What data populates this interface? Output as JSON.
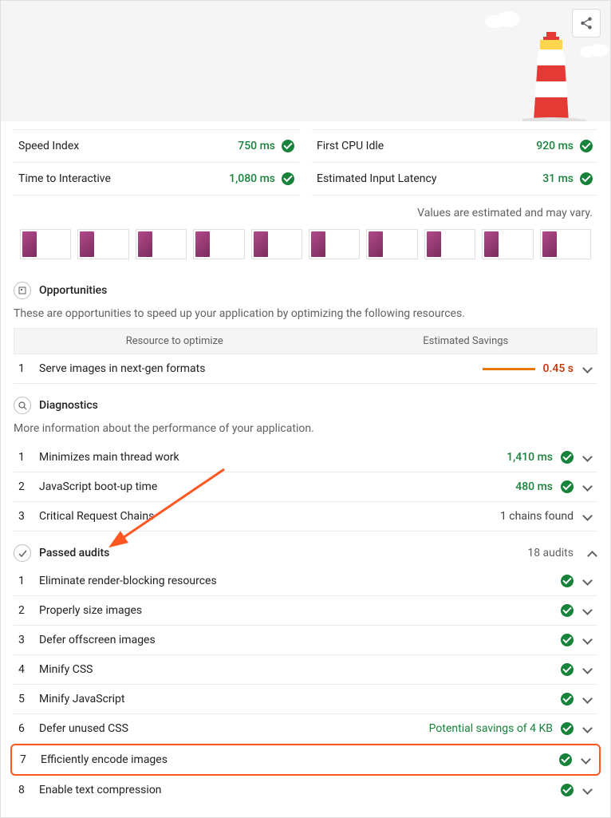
{
  "header": {
    "share_label": "Share"
  },
  "metrics": {
    "left": [
      {
        "label": "Speed Index",
        "value": "750 ms"
      },
      {
        "label": "Time to Interactive",
        "value": "1,080 ms"
      }
    ],
    "right": [
      {
        "label": "First CPU Idle",
        "value": "920 ms"
      },
      {
        "label": "Estimated Input Latency",
        "value": "31 ms"
      }
    ],
    "estimate_note": "Values are estimated and may vary."
  },
  "opportunities": {
    "title": "Opportunities",
    "desc": "These are opportunities to speed up your application by optimizing the following resources.",
    "col_left": "Resource to optimize",
    "col_right": "Estimated Savings",
    "rows": [
      {
        "num": "1",
        "text": "Serve images in next-gen formats",
        "savings": "0.45 s"
      }
    ]
  },
  "diagnostics": {
    "title": "Diagnostics",
    "desc": "More information about the performance of your application.",
    "rows": [
      {
        "num": "1",
        "text": "Minimizes main thread work",
        "value": "1,410 ms",
        "pass": true
      },
      {
        "num": "2",
        "text": "JavaScript boot-up time",
        "value": "480 ms",
        "pass": true
      },
      {
        "num": "3",
        "text": "Critical Request Chains",
        "value": "1 chains found",
        "pass": false
      }
    ]
  },
  "passed": {
    "title": "Passed audits",
    "count": "18 audits",
    "rows": [
      {
        "num": "1",
        "text": "Eliminate render-blocking resources",
        "extra": ""
      },
      {
        "num": "2",
        "text": "Properly size images",
        "extra": ""
      },
      {
        "num": "3",
        "text": "Defer offscreen images",
        "extra": ""
      },
      {
        "num": "4",
        "text": "Minify CSS",
        "extra": ""
      },
      {
        "num": "5",
        "text": "Minify JavaScript",
        "extra": ""
      },
      {
        "num": "6",
        "text": "Defer unused CSS",
        "extra": "Potential savings of 4 KB"
      },
      {
        "num": "7",
        "text": "Efficiently encode images",
        "extra": ""
      },
      {
        "num": "8",
        "text": "Enable text compression",
        "extra": ""
      }
    ]
  },
  "annotation": {
    "arrow_color": "#ff5722"
  }
}
